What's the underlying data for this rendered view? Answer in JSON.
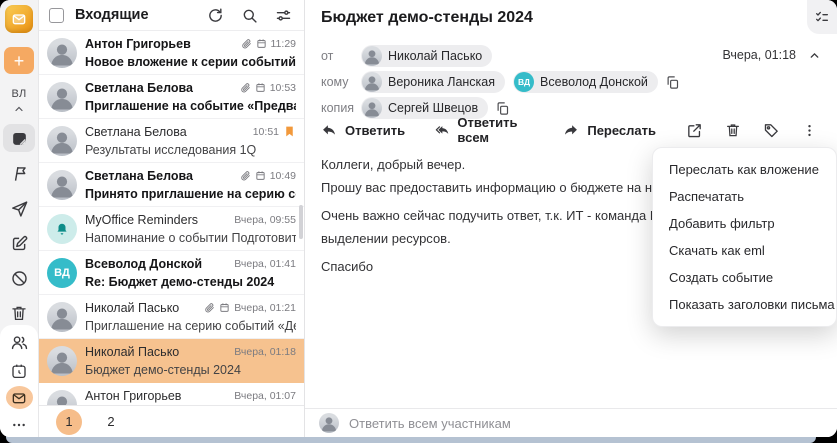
{
  "colors": {
    "accent": "#F5A962",
    "selection": "#F6C28F",
    "teal": "#35BCC9",
    "flag": "#F2993B",
    "reminder_bg": "#CDECEA",
    "reminder_icon": "#0D8D89",
    "page_current": "#F6BD8A"
  },
  "rail": {
    "compose": "+",
    "profile_initials": "ВЛ"
  },
  "list": {
    "title": "Входящие",
    "rows": [
      {
        "name": "Антон Григорьев",
        "snippet": "Новое вложение к серии событий «Аналити…",
        "time": "11:29",
        "unread": true,
        "attachment": true,
        "calendar": true,
        "avatar": {
          "type": "photo"
        }
      },
      {
        "name": "Светлана Белова",
        "snippet": "Приглашение на событие «Предварительно…",
        "time": "10:53",
        "unread": true,
        "attachment": true,
        "calendar": true,
        "avatar": {
          "type": "photo"
        }
      },
      {
        "name": "Светлана Белова",
        "snippet": "Результаты исследования 1Q",
        "time": "10:51",
        "flagged": true,
        "avatar": {
          "type": "photo"
        }
      },
      {
        "name": "Светлана Белова",
        "snippet": "Принято приглашение на серию событий «…",
        "time": "10:49",
        "unread": true,
        "attachment": true,
        "calendar": true,
        "avatar": {
          "type": "photo"
        }
      },
      {
        "name": "MyOffice Reminders",
        "snippet": "Напоминание о событии Подготовить отчет…",
        "time": "Вчера, 09:55",
        "avatar": {
          "type": "bell"
        }
      },
      {
        "name": "Всеволод Донской",
        "snippet": "Re: Бюджет демо-стенды 2024",
        "time": "Вчера, 01:41",
        "unread": true,
        "avatar": {
          "type": "initials",
          "initials": "ВД",
          "color": "#35BCC9"
        }
      },
      {
        "name": "Николай Пасько",
        "snippet": "Приглашение на серию событий «Демо стен…",
        "time": "Вчера, 01:21",
        "attachment": true,
        "calendar": true,
        "avatar": {
          "type": "photo"
        }
      },
      {
        "name": "Николай Пасько",
        "snippet": "Бюджет демо-стенды 2024",
        "time": "Вчера, 01:18",
        "selected": true,
        "avatar": {
          "type": "photo"
        }
      },
      {
        "name": "Антон Григорьев",
        "snippet": "",
        "time": "Вчера, 01:07",
        "avatar": {
          "type": "photo"
        }
      }
    ],
    "pagination": {
      "pages": [
        "1",
        "2"
      ],
      "current": 0
    }
  },
  "reader": {
    "subject": "Бюджет демо-стенды 2024",
    "date": "Вчера, 01:18",
    "from_label": "от",
    "to_label": "кому",
    "cc_label": "копия",
    "from": [
      {
        "name": "Николай Пасько",
        "avatar": {
          "type": "photo"
        }
      }
    ],
    "to": [
      {
        "name": "Вероника Ланская",
        "avatar": {
          "type": "photo"
        }
      },
      {
        "name": "Всеволод Донской",
        "avatar": {
          "type": "initials",
          "initials": "ВД",
          "color": "#35BCC9"
        }
      }
    ],
    "cc": [
      {
        "name": "Сергей Швецов",
        "avatar": {
          "type": "photo"
        }
      }
    ],
    "actions": {
      "reply": "Ответить",
      "reply_all": "Ответить всем",
      "forward": "Переслать"
    },
    "body_lines": [
      "Коллеги, добрый вечер.",
      "Прошу вас предоставить информацию о бюджете на наши демонстраци",
      "",
      "Очень важно сейчас подучить ответ, т.к. ИТ - команда Всеволода, уже",
      "выделении ресурсов.",
      "",
      "Спасибо"
    ],
    "reply_placeholder": "Ответить всем участникам"
  },
  "menu": {
    "items": [
      "Переслать как вложение",
      "Распечатать",
      "Добавить фильтр",
      "Скачать как eml",
      "Создать событие",
      "Показать заголовки письма"
    ]
  }
}
